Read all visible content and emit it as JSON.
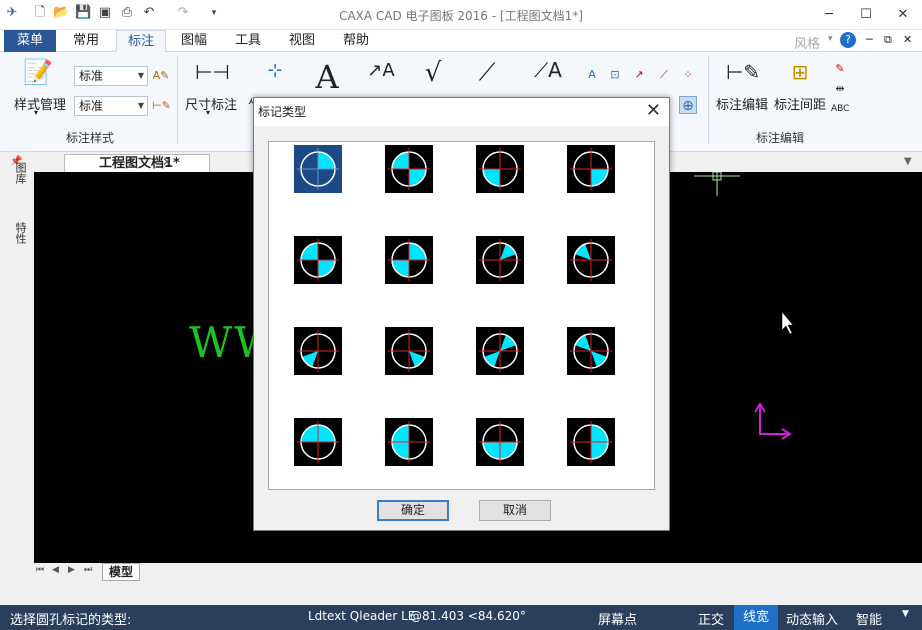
{
  "title": "CAXA CAD 电子图板 2016 - [工程图文档1*]",
  "menu_tabs": [
    {
      "label": "菜单"
    },
    {
      "label": "常用"
    },
    {
      "label": "标注"
    },
    {
      "label": "图幅"
    },
    {
      "label": "工具"
    },
    {
      "label": "视图"
    },
    {
      "label": "帮助"
    }
  ],
  "style_label": "风格",
  "ribbon": {
    "style_mgr": "样式管理",
    "combo1": "标准",
    "combo2": "标准",
    "group1": "标注样式",
    "dim": "尺寸标注",
    "coord": "坐标标注",
    "text": "文字",
    "base": "基准代号",
    "rough": "粗糙度",
    "weld": "焊接符号",
    "tol": "形位公差",
    "edit": "标注编辑",
    "space": "标注间距",
    "group3": "标注编辑"
  },
  "doc_tab": "工程图文档1*",
  "side_tabs": [
    "图库",
    "特性"
  ],
  "watermark": "WWW",
  "layout_tab": "模型",
  "dialog": {
    "title": "标记类型",
    "ok": "确定",
    "cancel": "取消"
  },
  "status": {
    "prompt": "选择圆孔标记的类型:",
    "cmd": "Ldtext Qleader LE",
    "coord": "@81.403 <84.620°",
    "screen_pt": "屏幕点",
    "ortho": "正交",
    "linewidth": "线宽",
    "dyn": "动态输入",
    "smart": "智能"
  },
  "colors": {
    "accent": "#2b5797",
    "fill": "#00e5ff",
    "canvas": "#000000"
  }
}
